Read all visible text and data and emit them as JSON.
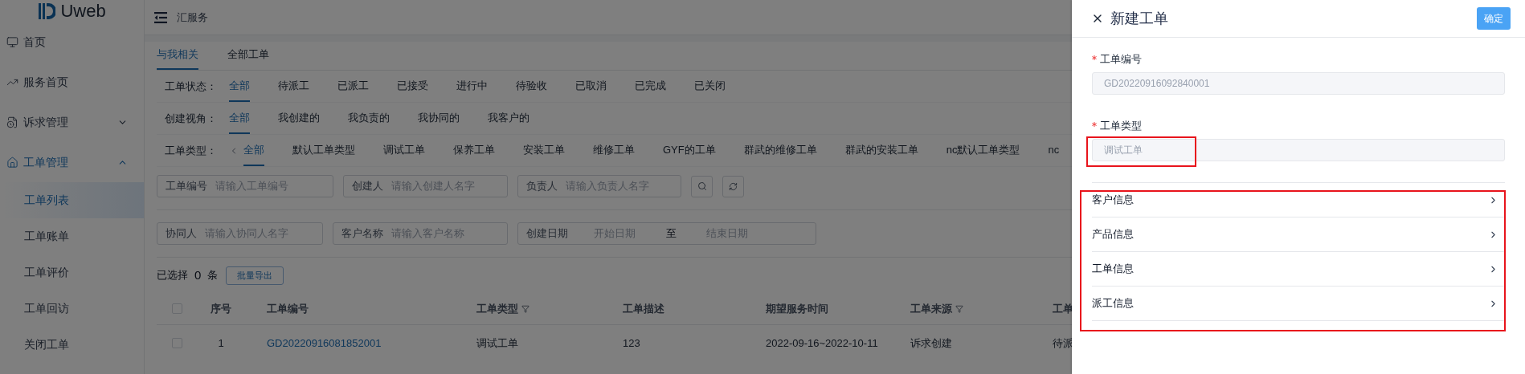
{
  "sidebar": {
    "logo": "Uweb",
    "items": [
      {
        "kind": "link",
        "label": "首页",
        "selected": false
      },
      {
        "kind": "link",
        "label": "服务首页",
        "selected": false
      },
      {
        "kind": "group",
        "label": "诉求管理",
        "expanded": false,
        "selected": false
      },
      {
        "kind": "group",
        "label": "工单管理",
        "expanded": true,
        "selected": true,
        "children": [
          {
            "label": "工单列表",
            "selected": true
          },
          {
            "label": "工单账单",
            "selected": false
          },
          {
            "label": "工单评价",
            "selected": false
          },
          {
            "label": "工单回访",
            "selected": false
          },
          {
            "label": "关闭工单",
            "selected": false
          }
        ]
      }
    ]
  },
  "header": {
    "title": "汇服务"
  },
  "tabs": [
    {
      "label": "与我相关",
      "selected": true
    },
    {
      "label": "全部工单",
      "selected": false
    }
  ],
  "filters": [
    {
      "label": "工单状态：",
      "scroll_arrow": false,
      "options": [
        {
          "label": "全部",
          "selected": true
        },
        {
          "label": "待派工",
          "selected": false
        },
        {
          "label": "已派工",
          "selected": false
        },
        {
          "label": "已接受",
          "selected": false
        },
        {
          "label": "进行中",
          "selected": false
        },
        {
          "label": "待验收",
          "selected": false
        },
        {
          "label": "已取消",
          "selected": false
        },
        {
          "label": "已完成",
          "selected": false
        },
        {
          "label": "已关闭",
          "selected": false
        }
      ]
    },
    {
      "label": "创建视角：",
      "scroll_arrow": false,
      "options": [
        {
          "label": "全部",
          "selected": true
        },
        {
          "label": "我创建的",
          "selected": false
        },
        {
          "label": "我负责的",
          "selected": false
        },
        {
          "label": "我协同的",
          "selected": false
        },
        {
          "label": "我客户的",
          "selected": false
        }
      ]
    },
    {
      "label": "工单类型：",
      "scroll_arrow": true,
      "options": [
        {
          "label": "全部",
          "selected": true
        },
        {
          "label": "默认工单类型",
          "selected": false
        },
        {
          "label": "调试工单",
          "selected": false
        },
        {
          "label": "保养工单",
          "selected": false
        },
        {
          "label": "安装工单",
          "selected": false
        },
        {
          "label": "维修工单",
          "selected": false
        },
        {
          "label": "GYF的工单",
          "selected": false
        },
        {
          "label": "群武的维修工单",
          "selected": false
        },
        {
          "label": "群武的安装工单",
          "selected": false
        },
        {
          "label": "nc默认工单类型",
          "selected": false
        },
        {
          "label": "nc",
          "selected": false
        }
      ]
    }
  ],
  "search_fields": [
    {
      "label": "工单编号",
      "placeholder": "请输入工单编号"
    },
    {
      "label": "创建人",
      "placeholder": "请输入创建人名字"
    },
    {
      "label": "负责人",
      "placeholder": "请输入负责人名字"
    }
  ],
  "search_fields_2": [
    {
      "label": "协同人",
      "placeholder": "请输入协同人名字"
    },
    {
      "label": "客户名称",
      "placeholder": "请输入客户名称"
    }
  ],
  "date_range": {
    "label": "创建日期",
    "start_placeholder": "开始日期",
    "separator": "至",
    "end_placeholder": "结束日期"
  },
  "selection": {
    "prefix": "已选择",
    "count": "0",
    "suffix": "条",
    "export_button": "批量导出"
  },
  "table": {
    "all_checked": false,
    "columns": [
      {
        "label": "序号",
        "filter": false
      },
      {
        "label": "工单编号",
        "filter": false
      },
      {
        "label": "工单类型",
        "filter": true
      },
      {
        "label": "工单描述",
        "filter": false
      },
      {
        "label": "期望服务时间",
        "filter": false
      },
      {
        "label": "工单来源",
        "filter": true
      },
      {
        "label": "工单",
        "filter": false
      }
    ],
    "rows": [
      {
        "checked": false,
        "cells": [
          "1",
          "GD20220916081852001",
          "调试工单",
          "123",
          "2022-09-16~2022-10-11",
          "诉求创建",
          "待派"
        ]
      }
    ]
  },
  "drawer": {
    "title": "新建工单",
    "confirm_button": "确定",
    "fields": [
      {
        "label": "工单编号",
        "required": true,
        "value": "GD20220916092840001",
        "disabled": true,
        "highlighted": false
      },
      {
        "label": "工单类型",
        "required": true,
        "value": "调试工单",
        "disabled": true,
        "highlighted": true
      }
    ],
    "sections": [
      {
        "label": "客户信息"
      },
      {
        "label": "产品信息"
      },
      {
        "label": "工单信息"
      },
      {
        "label": "派工信息"
      }
    ],
    "sections_highlighted": true
  }
}
